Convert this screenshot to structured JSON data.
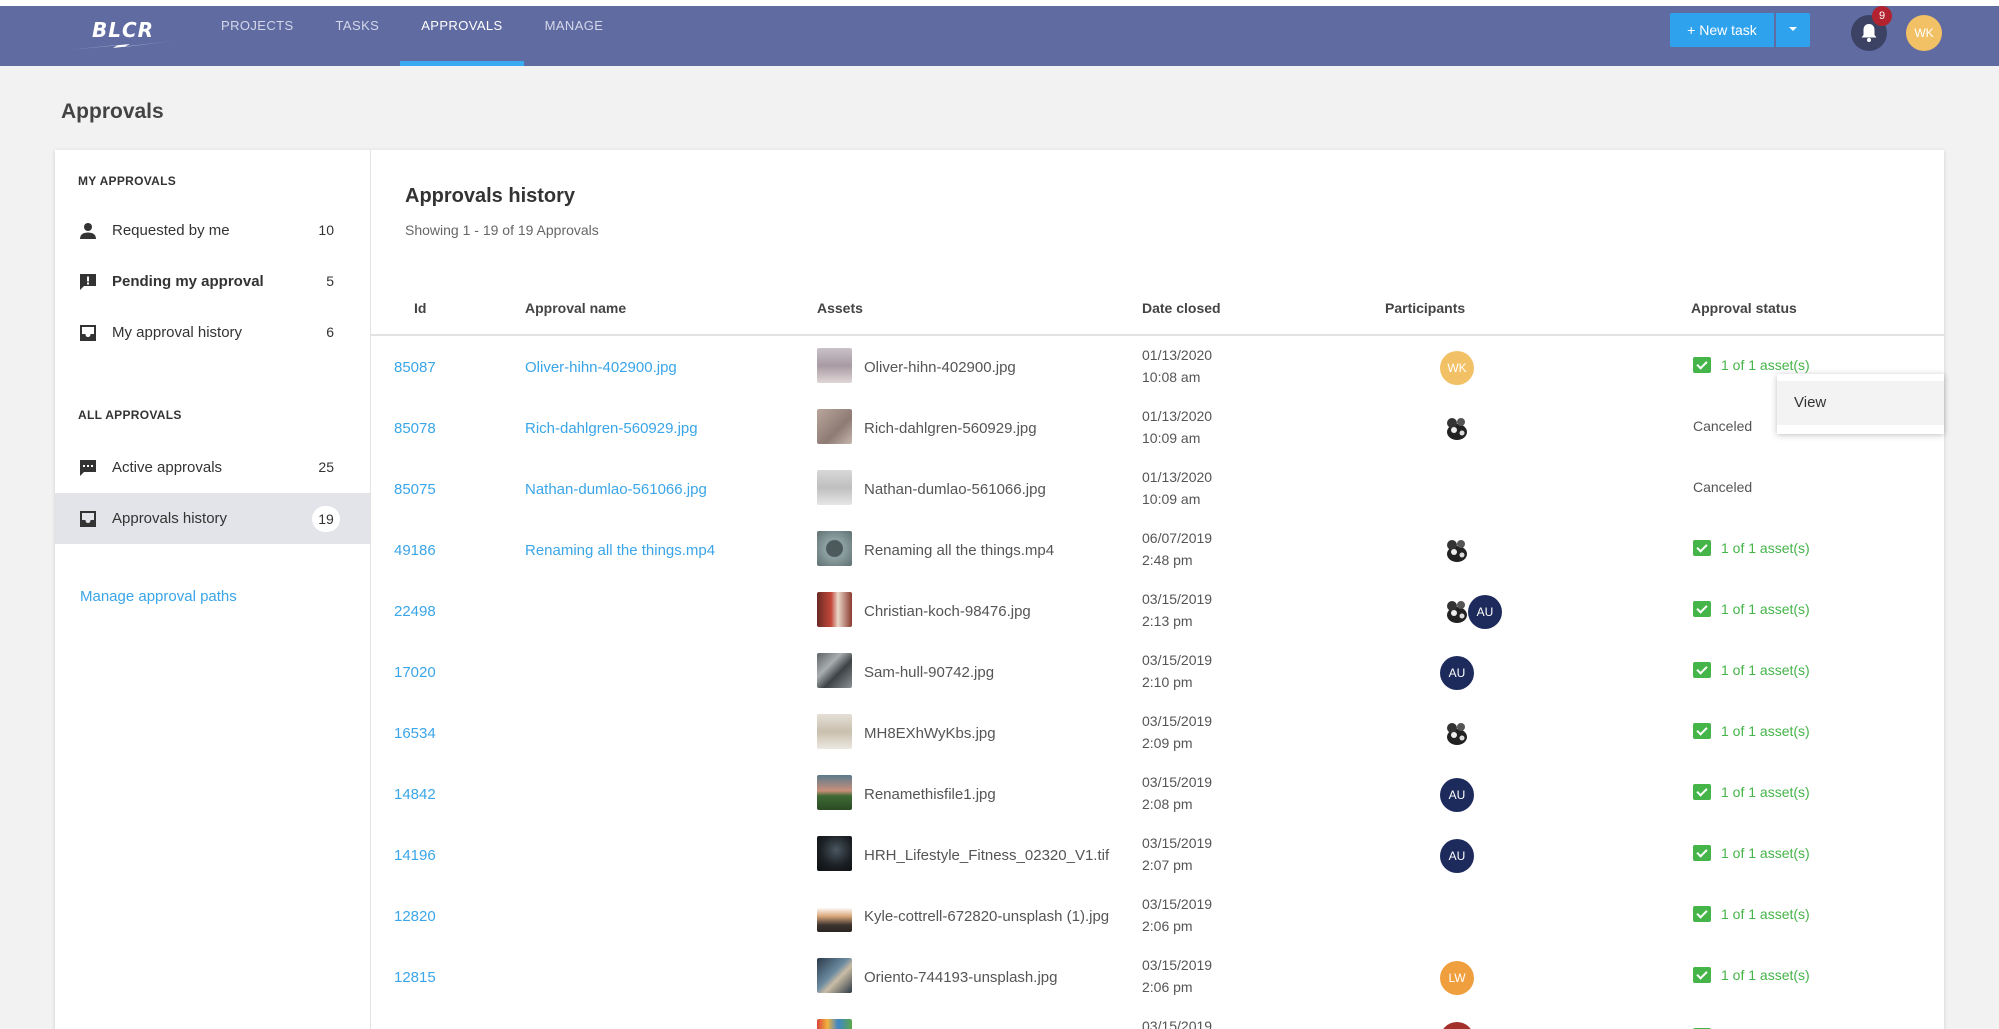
{
  "app": {
    "logo_text": "BLCR",
    "nav": [
      "PROJECTS",
      "TASKS",
      "APPROVALS",
      "MANAGE"
    ],
    "new_task_label": "+ New task",
    "notification_count": "9",
    "user_initials": "WK",
    "colors": {
      "header": "#606ba1",
      "accent": "#2ea2ec",
      "link": "#3aa5e8",
      "approved": "#45b449"
    }
  },
  "page_title": "Approvals",
  "sidebar": {
    "my_heading": "MY APPROVALS",
    "my_items": [
      {
        "label": "Requested by me",
        "count": "10",
        "icon": "person-icon"
      },
      {
        "label": "Pending my approval",
        "count": "5",
        "icon": "alert-chat-icon"
      },
      {
        "label": "My approval history",
        "count": "6",
        "icon": "inbox-icon"
      }
    ],
    "all_heading": "ALL APPROVALS",
    "all_items": [
      {
        "label": "Active approvals",
        "count": "25",
        "icon": "chat-icon"
      },
      {
        "label": "Approvals history",
        "count": "19",
        "icon": "inbox-icon"
      }
    ],
    "manage_link": "Manage approval paths"
  },
  "history": {
    "title": "Approvals history",
    "subtitle": "Showing 1 - 19 of 19 Approvals",
    "columns": [
      "Id",
      "Approval name",
      "Assets",
      "Date closed",
      "Participants",
      "Approval status"
    ],
    "rows": [
      {
        "id": "85087",
        "name": "Oliver-hihn-402900.jpg",
        "asset": "Oliver-hihn-402900.jpg",
        "date": "01/13/2020",
        "time": "10:08 am",
        "status": "1 of 1 asset(s)"
      },
      {
        "id": "85078",
        "name": "Rich-dahlgren-560929.jpg",
        "asset": "Rich-dahlgren-560929.jpg",
        "date": "01/13/2020",
        "time": "10:09 am",
        "status": "Canceled"
      },
      {
        "id": "85075",
        "name": "Nathan-dumlao-561066.jpg",
        "asset": "Nathan-dumlao-561066.jpg",
        "date": "01/13/2020",
        "time": "10:09 am",
        "status": "Canceled"
      },
      {
        "id": "49186",
        "name": "Renaming all the things.mp4",
        "asset": "Renaming all the things.mp4",
        "date": "06/07/2019",
        "time": "2:48 pm",
        "status": "1 of 1 asset(s)"
      },
      {
        "id": "22498",
        "name": "",
        "asset": "Christian-koch-98476.jpg",
        "date": "03/15/2019",
        "time": "2:13 pm",
        "status": "1 of 1 asset(s)"
      },
      {
        "id": "17020",
        "name": "",
        "asset": "Sam-hull-90742.jpg",
        "date": "03/15/2019",
        "time": "2:10 pm",
        "status": "1 of 1 asset(s)"
      },
      {
        "id": "16534",
        "name": "",
        "asset": "MH8EXhWyKbs.jpg",
        "date": "03/15/2019",
        "time": "2:09 pm",
        "status": "1 of 1 asset(s)"
      },
      {
        "id": "14842",
        "name": "",
        "asset": "Renamethisfile1.jpg",
        "date": "03/15/2019",
        "time": "2:08 pm",
        "status": "1 of 1 asset(s)"
      },
      {
        "id": "14196",
        "name": "",
        "asset": "HRH_Lifestyle_Fitness_02320_V1.tif",
        "date": "03/15/2019",
        "time": "2:07 pm",
        "status": "1 of 1 asset(s)"
      },
      {
        "id": "12820",
        "name": "",
        "asset": "Kyle-cottrell-672820-unsplash (1).jpg",
        "date": "03/15/2019",
        "time": "2:06 pm",
        "status": "1 of 1 asset(s)"
      },
      {
        "id": "12815",
        "name": "",
        "asset": "Oriento-744193-unsplash.jpg",
        "date": "03/15/2019",
        "time": "2:06 pm",
        "status": "1 of 1 asset(s)"
      },
      {
        "id": "",
        "name": "",
        "asset": "",
        "date": "03/15/2019",
        "time": "",
        "status": ""
      }
    ],
    "participants": {
      "au": "AU",
      "lw": "LW"
    }
  },
  "context_menu": {
    "view_label": "View"
  }
}
